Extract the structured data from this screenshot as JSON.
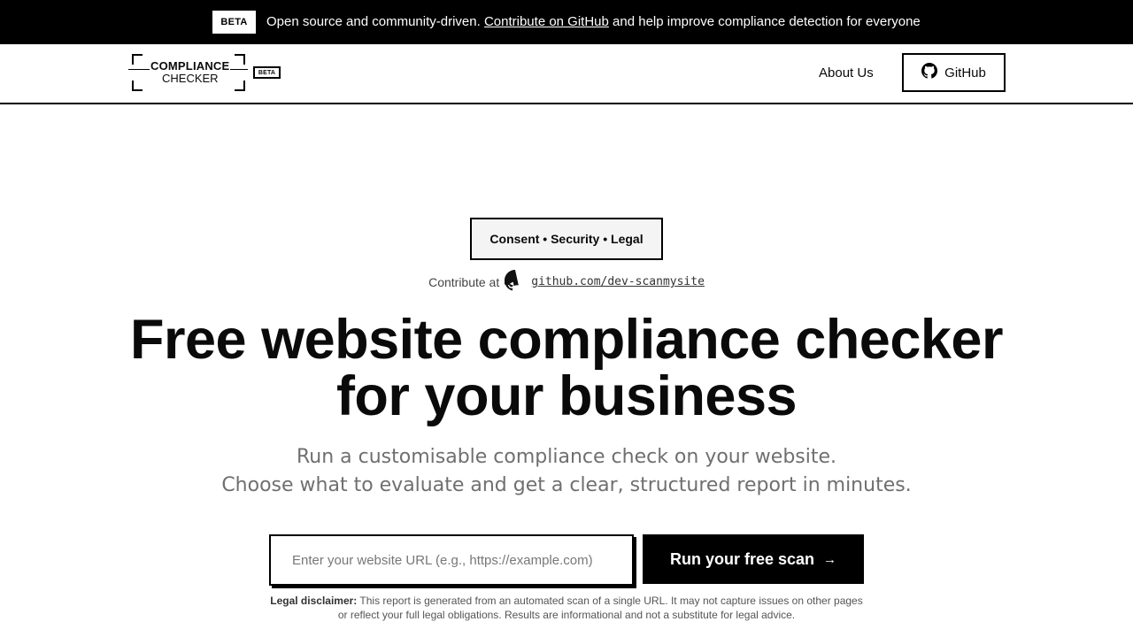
{
  "announcement": {
    "badge": "BETA",
    "text_before": "Open source and community-driven.",
    "link_text": "Contribute on GitHub",
    "text_after": "and help improve compliance detection for everyone"
  },
  "header": {
    "logo_line1": "COMPLIANCE",
    "logo_line2": "CHECKER",
    "logo_badge": "BETA",
    "nav_about": "About Us",
    "github_label": "GitHub"
  },
  "hero": {
    "tagline": "Consent • Security • Legal",
    "contribute_prefix": "Contribute at",
    "repo_link": "github.com/dev-scanmysite",
    "headline_line1": "Free website compliance checker",
    "headline_line2": "for your business",
    "sub_line1": "Run a customisable compliance check on your website.",
    "sub_line2": "Choose what to evaluate and get a clear, structured report in minutes."
  },
  "scan": {
    "input_value": "",
    "input_placeholder": "Enter your website URL (e.g., https://example.com)",
    "button_label": "Run your free scan",
    "button_icon": "arrow-right-icon"
  },
  "disclaimer": {
    "label": "Legal disclaimer:",
    "text": "This report is generated from an automated scan of a single URL. It may not capture issues on other pages or reflect your full legal obligations. Results are informational and not a substitute for legal advice."
  },
  "colors": {
    "primary": "#000000",
    "background": "#ffffff",
    "muted_text": "#6f6f6f",
    "tagline_bg": "#f4f4f4"
  }
}
